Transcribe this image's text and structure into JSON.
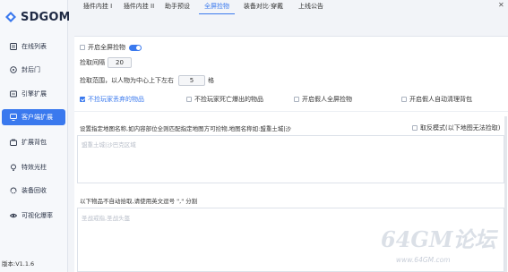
{
  "app": {
    "logo_text": "SDGOM",
    "version": "版本:V1.1.6"
  },
  "sidebar": {
    "items": [
      {
        "label": "在线列表",
        "icon": "list-icon"
      },
      {
        "label": "封后门",
        "icon": "shield-icon"
      },
      {
        "label": "引擎扩展",
        "icon": "engine-icon"
      },
      {
        "label": "客户端扩展",
        "icon": "client-icon",
        "active": true
      },
      {
        "label": "扩展背包",
        "icon": "bag-icon"
      },
      {
        "label": "特效光柱",
        "icon": "light-icon"
      },
      {
        "label": "装备回收",
        "icon": "recycle-icon"
      },
      {
        "label": "可视化爆率",
        "icon": "eye-icon"
      }
    ]
  },
  "tabs": [
    {
      "label": "插件内挂 I"
    },
    {
      "label": "插件内挂 II"
    },
    {
      "label": "助手预设"
    },
    {
      "label": "全屏捡物",
      "active": true
    },
    {
      "label": "装备对比·穿戴"
    },
    {
      "label": "上线公告"
    }
  ],
  "pickup": {
    "enable_label": "开启全屏捡物",
    "interval_label": "捡取间隔",
    "interval_value": "20",
    "range_label": "捡取范围，以人物为中心上下左右",
    "range_value": "5",
    "range_unit": "格",
    "options": [
      {
        "label": "不捡玩家丢弃的物品",
        "checked": true
      },
      {
        "label": "不捡玩家死亡爆出的物品",
        "checked": false
      },
      {
        "label": "开启假人全屏捡物",
        "checked": false
      },
      {
        "label": "开启假人自动清理背包",
        "checked": false
      }
    ],
    "map_section_label": "设置指定地图名称,如内容部位全则匹配指定地图方可捡物,地图名称如:盟重土城|沙",
    "reverse_label": "取反模式(以下地图无法捡取)",
    "map_placeholder": "盟重土城|沙巴克区域",
    "exclude_label": "以下物品不自动拾取,请使用英文逗号 \",\" 分割",
    "exclude_placeholder": "圣战戒指,圣战头盔"
  },
  "watermark": {
    "main": "64GM论坛",
    "sub": "www.64GM.com"
  },
  "colors": {
    "accent": "#3a79ee",
    "sidebar_bg": "#f6f8fb",
    "page_bg": "#f2f4f8"
  }
}
